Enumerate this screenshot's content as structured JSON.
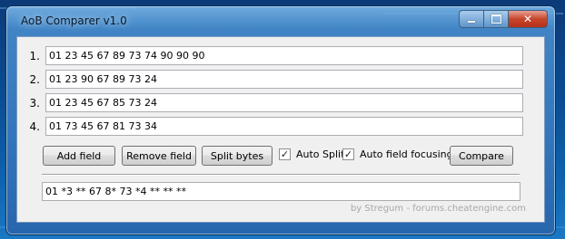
{
  "window": {
    "title": "AoB Comparer v1.0",
    "accent_color": "#4a8ccc",
    "close_color": "#c7452b",
    "caption_icons": [
      "minimize-icon",
      "maximize-icon",
      "close-icon"
    ]
  },
  "fields": [
    {
      "number": "1.",
      "value": "01 23 45 67 89 73 74 90 90 90"
    },
    {
      "number": "2.",
      "value": "01 23 90 67 89 73 24"
    },
    {
      "number": "3.",
      "value": "01 23 45 67 85 73 24"
    },
    {
      "number": "4.",
      "value": "01 73 45 67 81 73 34"
    }
  ],
  "toolbar": {
    "add_field": "Add field",
    "remove_field": "Remove field",
    "split_bytes": "Split bytes",
    "auto_split": {
      "label": "Auto Split",
      "checked": true
    },
    "auto_focus": {
      "label": "Auto field focusing",
      "checked": true
    },
    "compare": "Compare"
  },
  "result": {
    "value": "01 *3 ** 67 8* 73 *4 ** ** **"
  },
  "credit": "by Stregum - forums.cheatengine.com"
}
